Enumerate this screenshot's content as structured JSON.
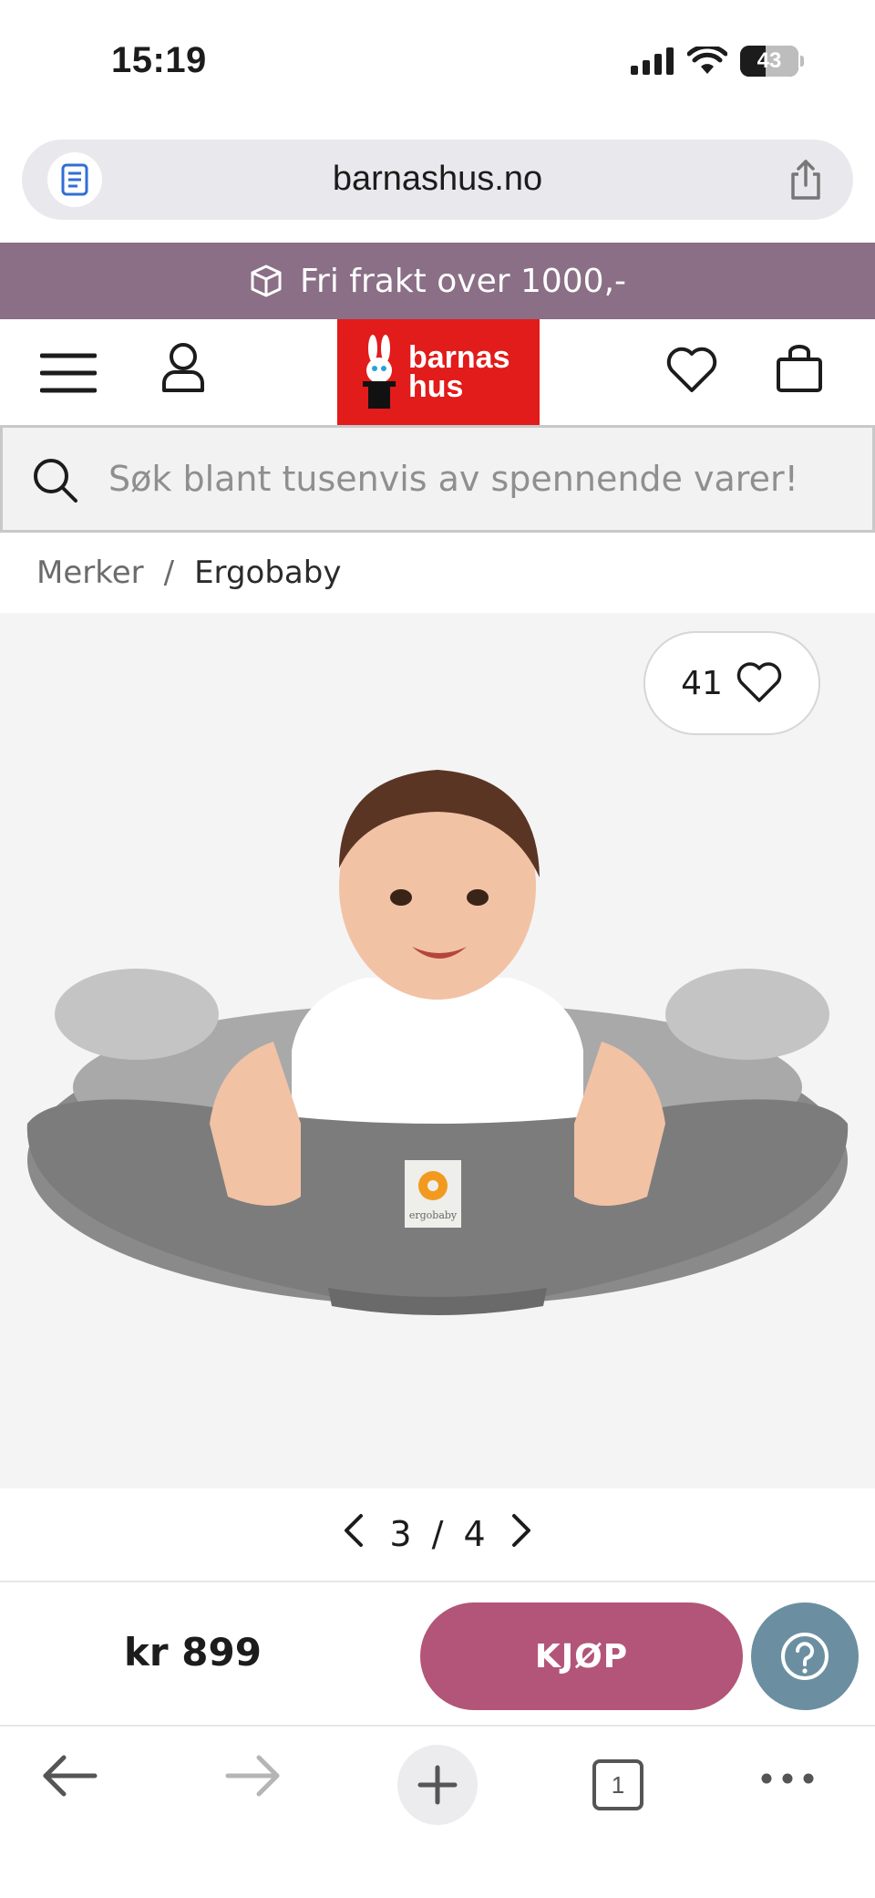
{
  "status_bar": {
    "time": "15:19",
    "battery": "43",
    "battery_level": 0.43
  },
  "url_bar": {
    "url": "barnashus.no"
  },
  "promo": {
    "text": "Fri frakt over 1000,-"
  },
  "header": {
    "logo_line1": "barnas",
    "logo_line2": "hus"
  },
  "search": {
    "placeholder": "Søk blant tusenvis av spennende varer!"
  },
  "breadcrumb": {
    "items": [
      "Merker",
      "Ergobaby"
    ],
    "separator": "/"
  },
  "product": {
    "favorites_count": "41",
    "image_label": "ergobaby"
  },
  "pager": {
    "current": "3",
    "total": "4",
    "separator": "/"
  },
  "purchase": {
    "price": "kr 899",
    "buy_label": "KJØP"
  },
  "toolbar": {
    "tab_count": "1"
  },
  "colors": {
    "promo_bg": "#8a6f86",
    "logo_bg": "#e21b1b",
    "buy_button": "#b35578",
    "help_button": "#6b8fa1"
  }
}
